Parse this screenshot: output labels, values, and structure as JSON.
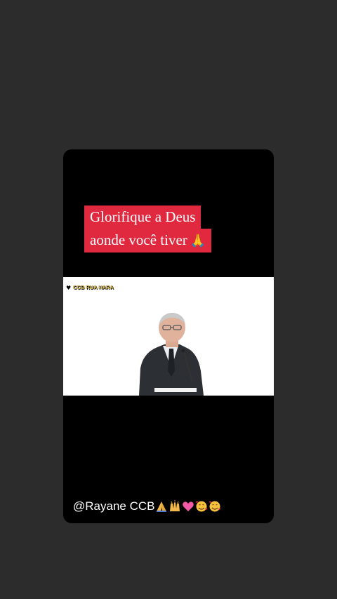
{
  "story": {
    "caption": {
      "line1": "Glorifique a Deus",
      "line2": "aonde você tiver",
      "pray_icon": "🙏"
    },
    "video": {
      "watermark_text": "CCB RUA HARA"
    },
    "handle": "@Rayane CCB",
    "emoji_icons": [
      "praying-hands-icon",
      "raised-hands-icon",
      "pink-heart-icon",
      "smiling-face-with-hearts-icon",
      "smiling-face-with-hearts-icon"
    ]
  },
  "colors": {
    "background": "#2d2c2c",
    "card": "#000000",
    "caption_highlight": "#e0283f",
    "watermark": "#e7c64a"
  }
}
